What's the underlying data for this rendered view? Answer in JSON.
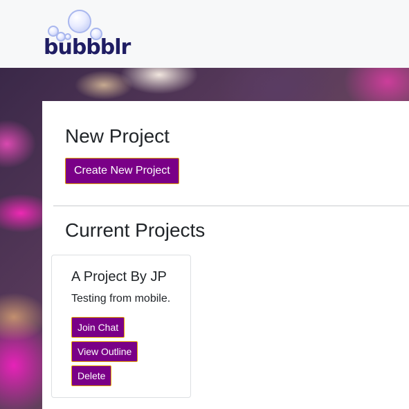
{
  "navbar": {
    "brand": "bubbblr"
  },
  "new_project": {
    "title": "New Project",
    "create_button": "Create New Project"
  },
  "current_projects": {
    "title": "Current Projects",
    "projects": [
      {
        "title": "A Project By JP",
        "description": "Testing from mobile.",
        "join_button": "Join Chat",
        "outline_button": "View Outline",
        "delete_button": "Delete"
      }
    ]
  },
  "colors": {
    "button_bg": "#7a0087",
    "button_border": "#e9a800",
    "brand_text": "#1f1d63"
  }
}
